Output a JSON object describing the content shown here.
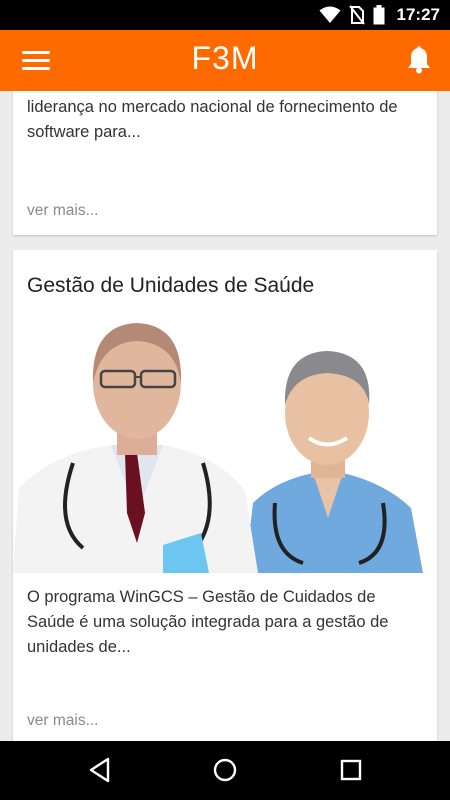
{
  "status_bar": {
    "time": "17:27",
    "icons": [
      "wifi-icon",
      "no-sim-icon",
      "battery-icon"
    ]
  },
  "app_bar": {
    "title": "F3M",
    "menu_icon": "hamburger-menu-icon",
    "notification_icon": "bell-icon",
    "color": "#ff6a00"
  },
  "feed": [
    {
      "title": "",
      "excerpt": "liderança no mercado nacional de fornecimento de software para...",
      "more_label": "ver mais..."
    },
    {
      "title": "Gestão de Unidades de Saúde",
      "image": "two doctors in white coat and blue scrubs with stethoscopes",
      "excerpt": "O programa WinGCS – Gestão de Cuidados de Saúde é uma solução integrada para a gestão de unidades de...",
      "more_label": "ver mais..."
    }
  ],
  "nav_bar": {
    "buttons": [
      "back-icon",
      "home-icon",
      "recents-icon"
    ]
  }
}
